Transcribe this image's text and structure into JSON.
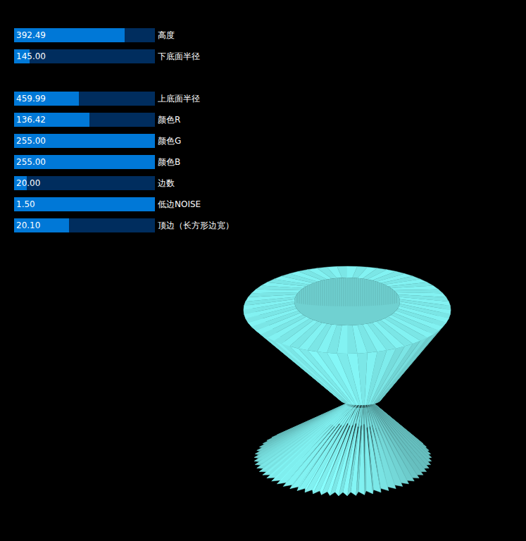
{
  "slider_groups": [
    [
      {
        "label": "高度",
        "value": "392.49",
        "level": 0.785
      },
      {
        "label": "下底面半径",
        "value": "145.00",
        "level": 0.11
      }
    ],
    [
      {
        "label": "上底面半径",
        "value": "459.99",
        "level": 0.46
      },
      {
        "label": "颜色R",
        "value": "136.42",
        "level": 0.535
      },
      {
        "label": "颜色G",
        "value": "255.00",
        "level": 1.0
      },
      {
        "label": "颜色B",
        "value": "255.00",
        "level": 1.0
      },
      {
        "label": "边数",
        "value": "20.00",
        "level": 0.09
      },
      {
        "label": "低边NOISE",
        "value": "1.50",
        "level": 1.0
      },
      {
        "label": "顶边（长方形边宽）",
        "value": "20.10",
        "level": 0.39
      }
    ]
  ]
}
